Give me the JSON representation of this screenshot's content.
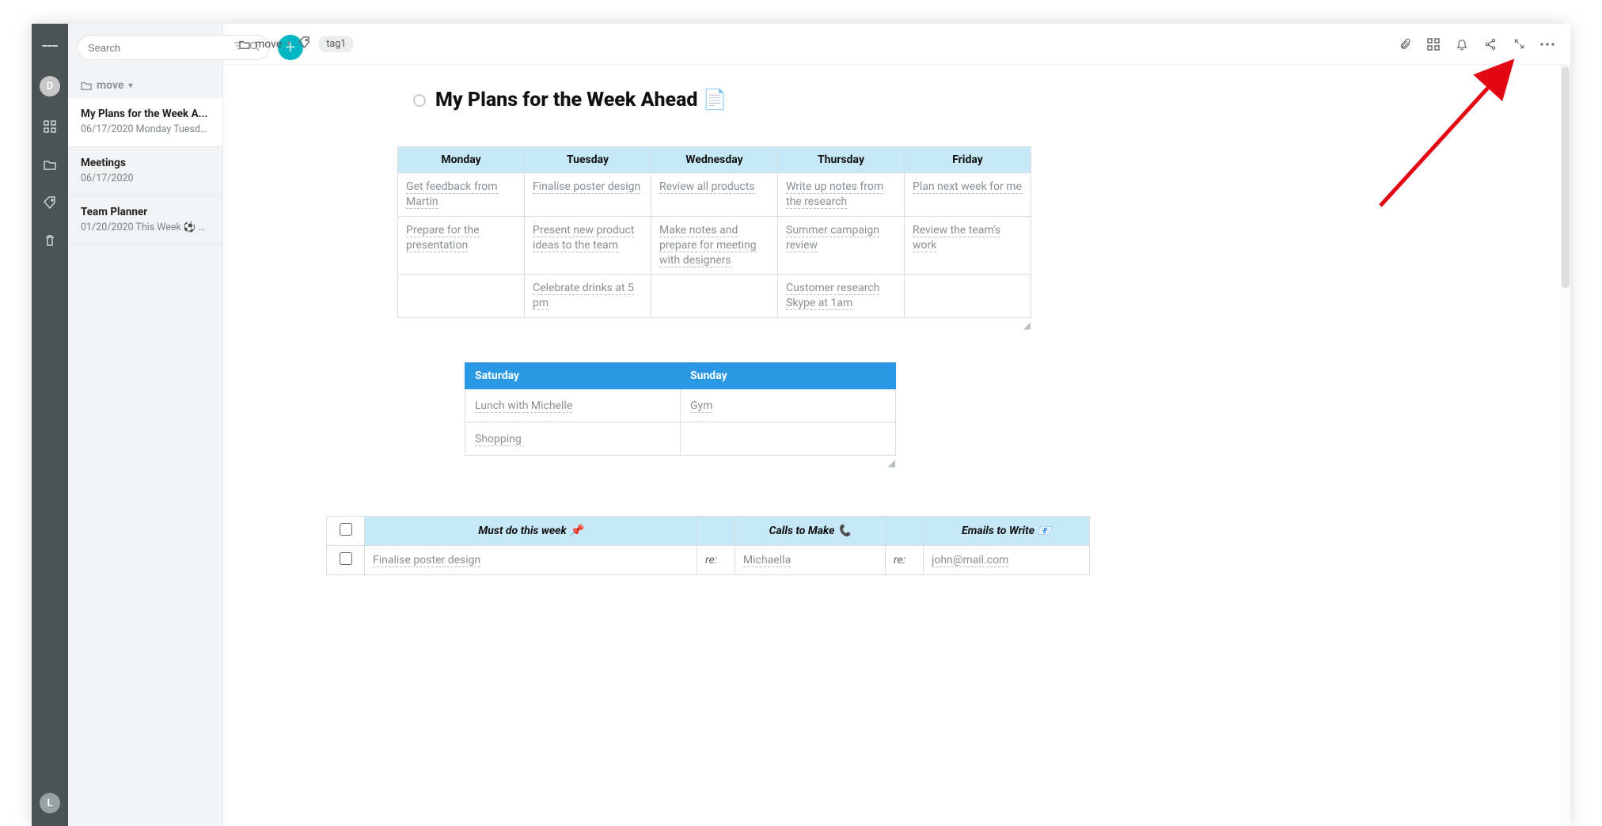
{
  "rail": {
    "avatar_top": "D",
    "avatar_bottom": "L"
  },
  "sidebar": {
    "search_placeholder": "Search",
    "folder_label": "move",
    "notes": [
      {
        "title": "My Plans for the Week A...",
        "preview": "06/17/2020 Monday Tuesda..."
      },
      {
        "title": "Meetings",
        "preview": "06/17/2020"
      },
      {
        "title": "Team Planner",
        "preview": "01/20/2020 This Week ⚽ G..."
      }
    ]
  },
  "breadcrumb": {
    "folder": "move",
    "tag": "tag1"
  },
  "page": {
    "title": "My Plans for the Week Ahead",
    "title_emoji": "📄"
  },
  "weekday": {
    "headers": [
      "Monday",
      "Tuesday",
      "Wednesday",
      "Thursday",
      "Friday"
    ],
    "rows": [
      [
        "Get feedback from Martin",
        "Finalise poster design",
        "Review all products",
        "Write up notes from the research",
        "Plan next week for me"
      ],
      [
        "Prepare for the presentation",
        "Present new product ideas to the team",
        "Make notes and prepare for meeting with designers",
        "Summer campaign review",
        "Review the team's work"
      ],
      [
        "",
        "Celebrate drinks at 5 pm",
        "",
        "Customer research Skype at 1am",
        ""
      ]
    ]
  },
  "weekend": {
    "headers": [
      "Saturday",
      "Sunday"
    ],
    "rows": [
      [
        "Lunch with Michelle",
        "Gym"
      ],
      [
        "Shopping",
        ""
      ]
    ]
  },
  "checklist": {
    "headers": {
      "must": "Must do this week 📌",
      "calls": "Calls to Make 📞",
      "emails": "Emails to Write 📧"
    },
    "re_label": "re:",
    "rows": [
      {
        "must": "Finalise poster design",
        "call": "Michaella",
        "email": "john@mail.com"
      }
    ]
  }
}
